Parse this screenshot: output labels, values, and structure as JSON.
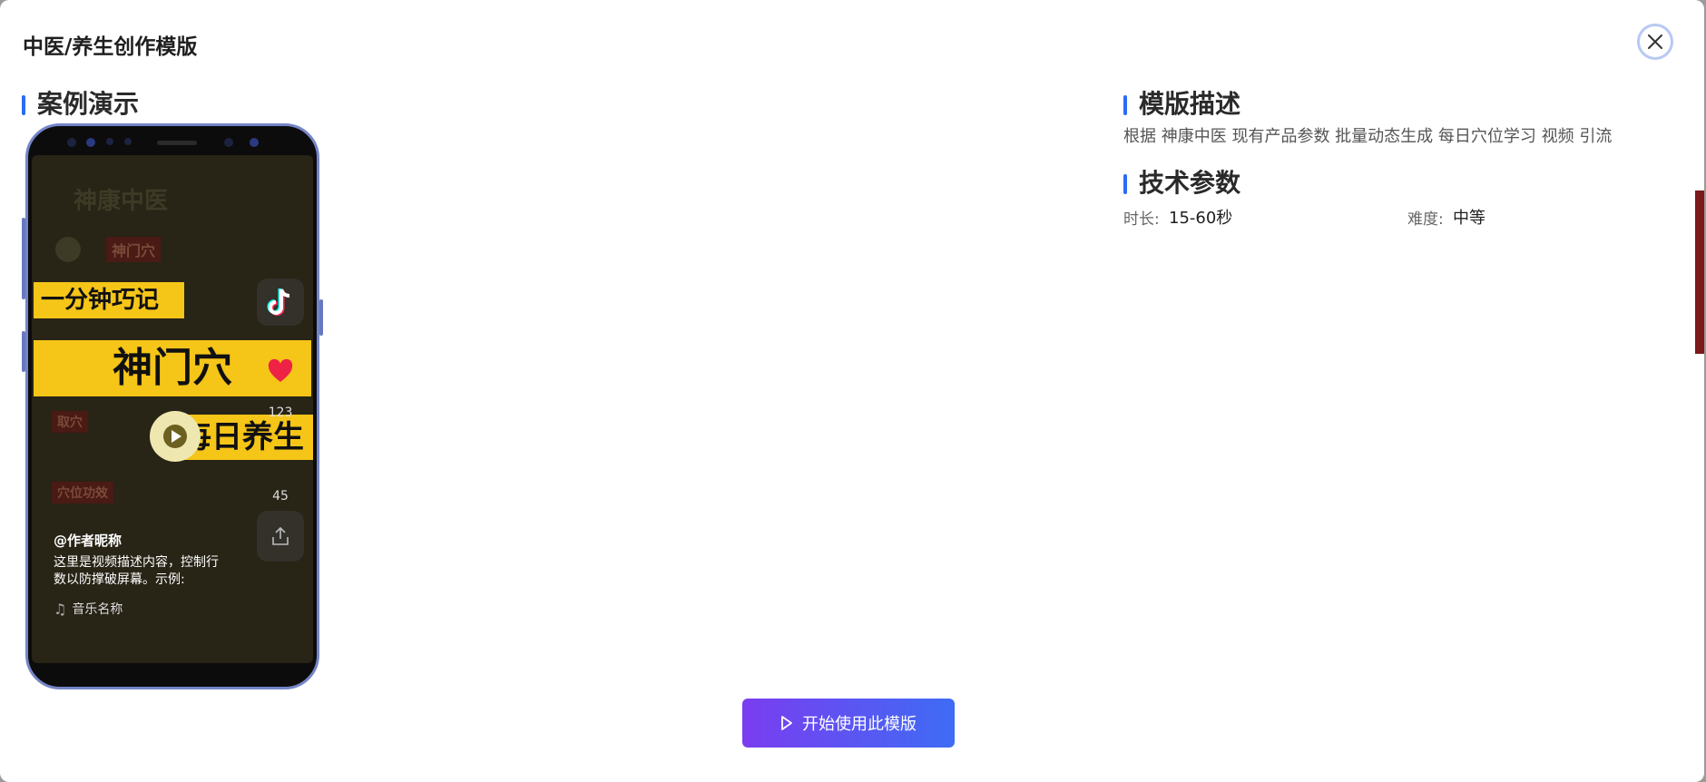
{
  "modal": {
    "title": "中医/养生创作模版",
    "close_icon": "close-icon"
  },
  "demo": {
    "heading": "案例演示"
  },
  "description": {
    "heading": "模版描述",
    "text": "根据 神康中医 现有产品参数 批量动态生成 每日穴位学习 视频 引流"
  },
  "params": {
    "heading": "技术参数",
    "duration_label": "时长:",
    "duration_value": "15-60秒",
    "difficulty_label": "难度:",
    "difficulty_value": "中等"
  },
  "video": {
    "bg_brand": "神康中医",
    "bg_point": "神门穴",
    "bg_section1": "取穴",
    "bg_section2": "穴位功效",
    "banner_top": "一分钟巧记",
    "banner_main": "神门穴",
    "banner_bottom": "每日养生",
    "likes": "123",
    "comments": "45",
    "author": "@作者昵称",
    "desc": "这里是视频描述内容，控制行数以防撑破屏幕。示例:",
    "music": "音乐名称"
  },
  "actions": {
    "start_label": "开始使用此模版"
  },
  "colors": {
    "accent": "#2b6cf6",
    "button_from": "#7a3df0",
    "button_to": "#3e6cf5",
    "banner": "#f5c518"
  }
}
